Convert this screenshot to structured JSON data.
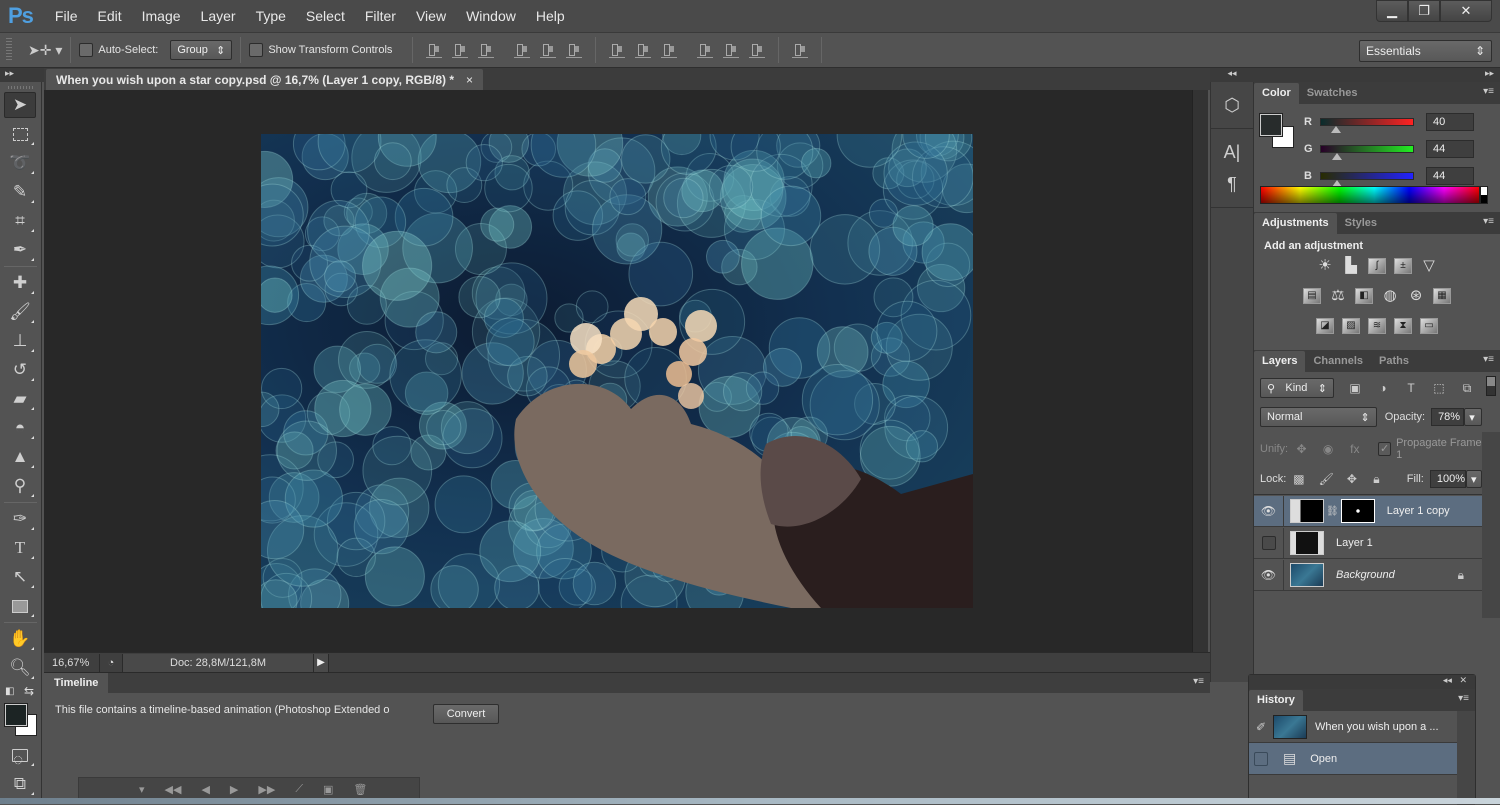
{
  "app": {
    "logo": "Ps",
    "menu": [
      "File",
      "Edit",
      "Image",
      "Layer",
      "Type",
      "Select",
      "Filter",
      "View",
      "Window",
      "Help"
    ]
  },
  "window_controls": {
    "minimize": "▁",
    "restore": "❐",
    "close": "✕"
  },
  "options_bar": {
    "auto_select_label": "Auto-Select:",
    "auto_select_checked": false,
    "auto_select_mode": "Group",
    "show_transform_label": "Show Transform Controls",
    "show_transform_checked": false,
    "workspace": "Essentials"
  },
  "document": {
    "tab_title": "When you wish upon a star copy.psd @ 16,7% (Layer 1 copy, RGB/8) *",
    "close": "×"
  },
  "status_bar": {
    "zoom": "16,67%",
    "doc_info": "Doc: 28,8M/121,8M"
  },
  "timeline": {
    "tab": "Timeline",
    "message": "This file contains a timeline-based animation (Photoshop Extended o",
    "convert_label": "Convert"
  },
  "color_panel": {
    "tabs": [
      "Color",
      "Swatches"
    ],
    "active_tab": "Color",
    "channels": [
      {
        "label": "R",
        "value": "40",
        "fraction": 0.157
      },
      {
        "label": "G",
        "value": "44",
        "fraction": 0.173
      },
      {
        "label": "B",
        "value": "44",
        "fraction": 0.173
      }
    ],
    "foreground": "#282c2c",
    "background": "#ffffff"
  },
  "adjustments_panel": {
    "tabs": [
      "Adjustments",
      "Styles"
    ],
    "title": "Add an adjustment",
    "rows": [
      [
        "brightness-contrast",
        "levels",
        "curves",
        "exposure",
        "vibrance"
      ],
      [
        "hue-saturation",
        "color-balance",
        "black-white",
        "photo-filter",
        "channel-mixer",
        "color-lookup"
      ],
      [
        "invert",
        "posterize",
        "threshold",
        "selective-color",
        "gradient-map"
      ]
    ]
  },
  "layers_panel": {
    "tabs": [
      "Layers",
      "Channels",
      "Paths"
    ],
    "filter_kind": "Kind",
    "blend_mode": "Normal",
    "opacity_label": "Opacity:",
    "opacity": "78%",
    "unify_label": "Unify:",
    "propagate_label": "Propagate Frame 1",
    "propagate_checked": true,
    "lock_label": "Lock:",
    "fill_label": "Fill:",
    "fill": "100%",
    "layers": [
      {
        "name": "Layer 1 copy",
        "visible": true,
        "selected": true,
        "has_mask": true,
        "locked": false
      },
      {
        "name": "Layer 1",
        "visible": false,
        "selected": false,
        "has_mask": false,
        "locked": false
      },
      {
        "name": "Background",
        "visible": true,
        "selected": false,
        "has_mask": false,
        "locked": true
      }
    ]
  },
  "history_panel": {
    "tab": "History",
    "snapshot": "When you wish upon a ...",
    "states": [
      {
        "name": "Open",
        "selected": true
      }
    ]
  }
}
